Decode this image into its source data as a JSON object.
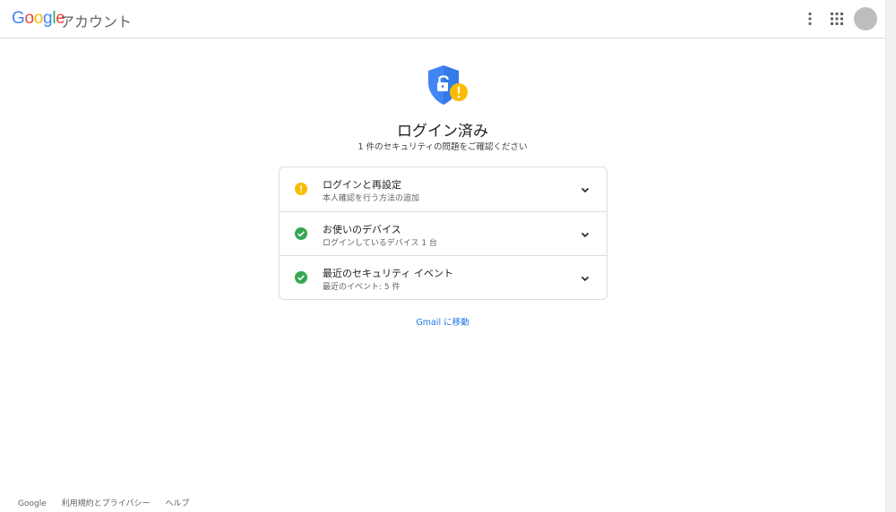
{
  "header": {
    "logo_text": "Google",
    "product_name": "アカウント",
    "more_icon": "more-vert-icon",
    "apps_icon": "apps-grid-icon",
    "logo_colors": [
      "#4285F4",
      "#EA4335",
      "#FBBC05",
      "#4285F4",
      "#34A853",
      "#EA4335"
    ]
  },
  "hero": {
    "icon": "shield-unlock-warning-icon",
    "title": "ログイン済み",
    "subtitle": "1 件のセキュリティの問題をご確認ください"
  },
  "issues": [
    {
      "status": "warning",
      "status_icon": "warning-icon",
      "title": "ログインと再設定",
      "subtitle": "本人確認を行う方法の追加"
    },
    {
      "status": "ok",
      "status_icon": "check-circle-icon",
      "title": "お使いのデバイス",
      "subtitle": "ログインしているデバイス 1 台"
    },
    {
      "status": "ok",
      "status_icon": "check-circle-icon",
      "title": "最近のセキュリティ イベント",
      "subtitle": "最近のイベント: 5 件"
    }
  ],
  "gmail_link": "Gmail に移動",
  "footer": {
    "links": [
      "Google",
      "利用規約とプライバシー",
      "ヘルプ"
    ]
  },
  "colors": {
    "accent": "#1a73e8",
    "warning": "#fbbc04",
    "success": "#34a853",
    "shield": "#4285f4"
  }
}
